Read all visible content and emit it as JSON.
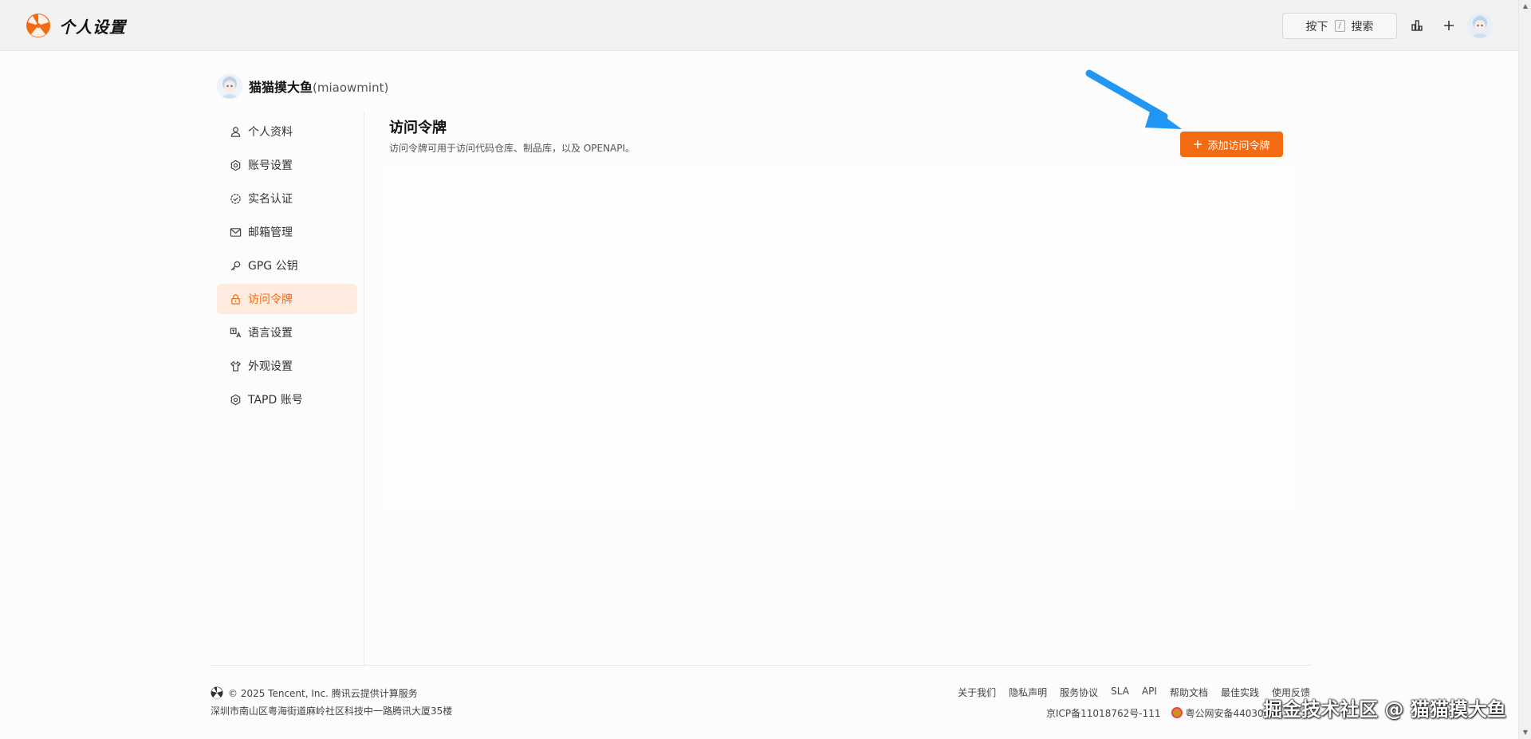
{
  "header": {
    "title": "个人设置",
    "search": {
      "press_label": "按下",
      "key": "/",
      "label": "搜索"
    },
    "brand_color": "#f26b12"
  },
  "user": {
    "display_name": "猫猫摸大鱼",
    "login": "(miaowmint)"
  },
  "sidebar": {
    "items": [
      {
        "label": "个人资料",
        "icon": "user-icon",
        "active": false
      },
      {
        "label": "账号设置",
        "icon": "settings-icon",
        "active": false
      },
      {
        "label": "实名认证",
        "icon": "verified-icon",
        "active": false
      },
      {
        "label": "邮箱管理",
        "icon": "mail-icon",
        "active": false
      },
      {
        "label": "GPG 公钥",
        "icon": "key-icon",
        "active": false
      },
      {
        "label": "访问令牌",
        "icon": "lock-icon",
        "active": true
      },
      {
        "label": "语言设置",
        "icon": "translate-icon",
        "active": false
      },
      {
        "label": "外观设置",
        "icon": "shirt-icon",
        "active": false
      },
      {
        "label": "TAPD 账号",
        "icon": "settings-icon",
        "active": false
      }
    ]
  },
  "main": {
    "title": "访问令牌",
    "description": "访问令牌可用于访问代码仓库、制品库，以及 OPENAPI。",
    "add_button_label": "添加访问令牌"
  },
  "footer": {
    "copyright": "© 2025 Tencent, Inc. 腾讯云提供计算服务",
    "address": "深圳市南山区粤海街道麻岭社区科技中一路腾讯大厦35楼",
    "links": [
      "关于我们",
      "隐私声明",
      "服务协议",
      "SLA",
      "API",
      "帮助文档",
      "最佳实践",
      "使用反馈"
    ],
    "icp": "京ICP备11018762号-111",
    "police_record": "粤公网安备44030000",
    "watermark": "掘金技术社区 @ 猫猫摸大鱼"
  }
}
